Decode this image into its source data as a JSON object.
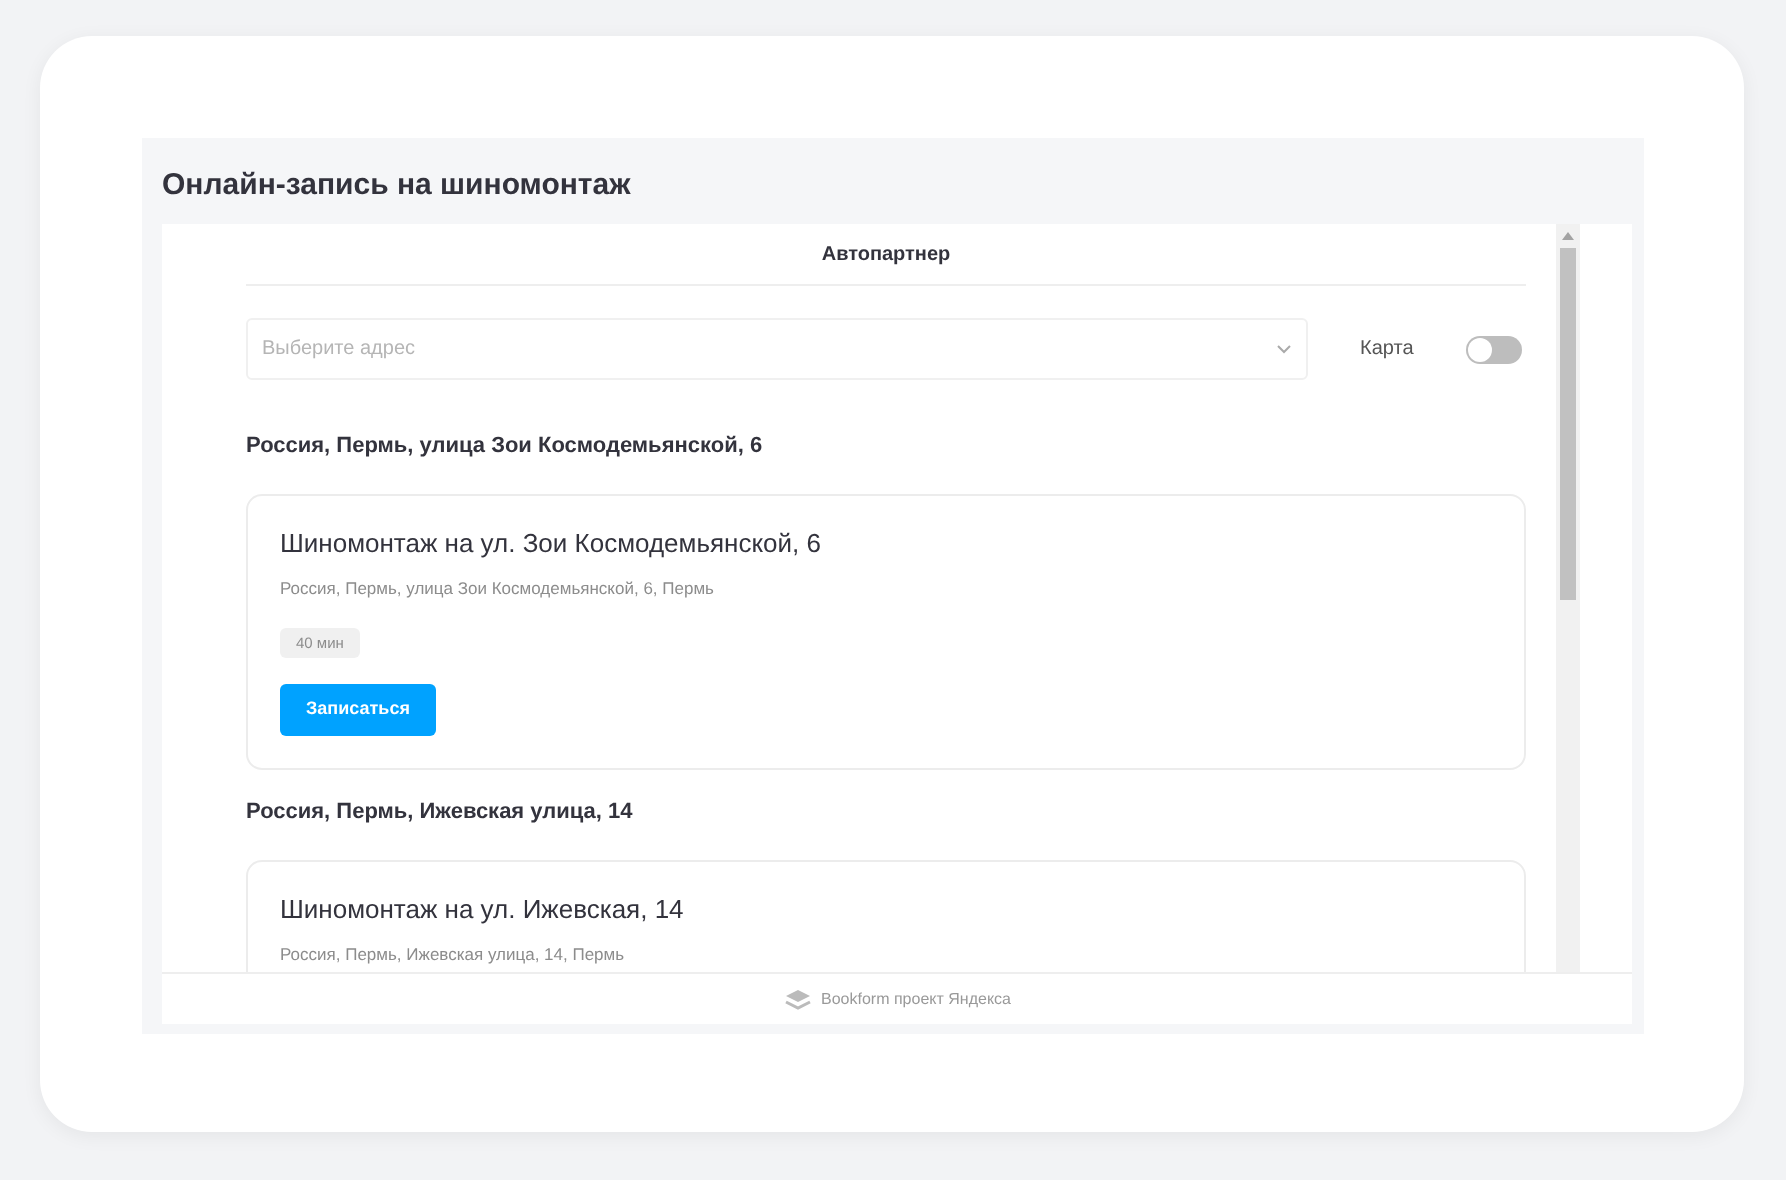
{
  "page_title": "Онлайн-запись на шиномонтаж",
  "company": "Автопартнер",
  "address_select": {
    "placeholder": "Выберите адрес"
  },
  "map_toggle": {
    "label": "Карта",
    "on": false
  },
  "locations": [
    {
      "heading": "Россия, Пермь, улица Зои Космодемьянской, 6",
      "service": {
        "title": "Шиномонтаж на ул. Зои Космодемьянской, 6",
        "address": "Россия, Пермь, улица Зои Космодемьянской, 6, Пермь",
        "duration": "40 мин",
        "button": "Записаться"
      }
    },
    {
      "heading": "Россия, Пермь, Ижевская улица, 14",
      "service": {
        "title": "Шиномонтаж на ул. Ижевская, 14",
        "address": "Россия, Пермь, Ижевская улица, 14, Пермь"
      }
    }
  ],
  "footer": "Bookform проект Яндекса"
}
